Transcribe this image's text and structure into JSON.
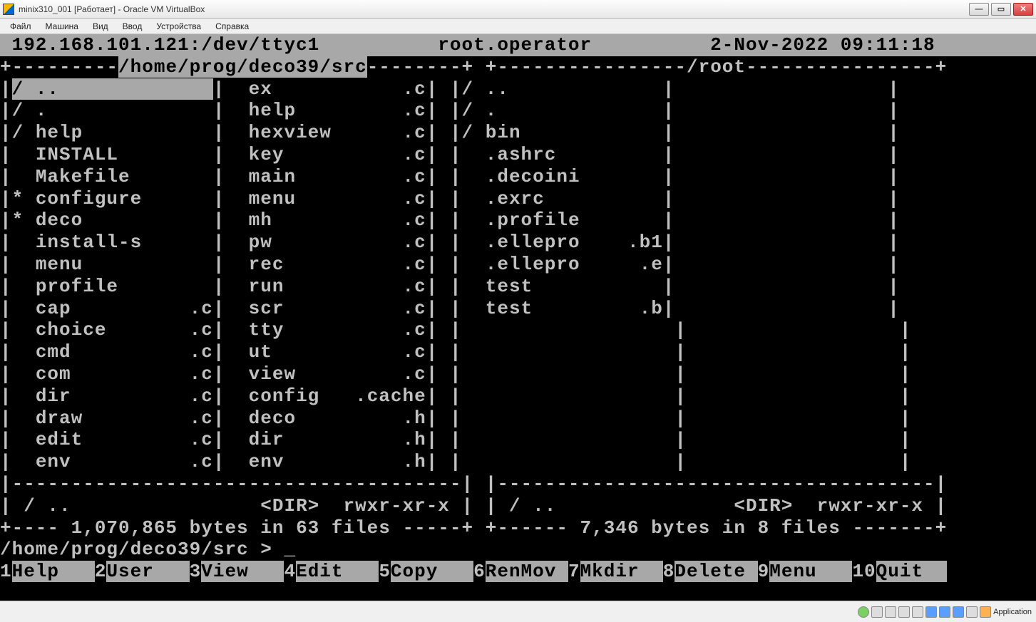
{
  "window": {
    "title": "minix310_001 [Работает] - Oracle VM VirtualBox"
  },
  "menubar": [
    "Файл",
    "Машина",
    "Вид",
    "Ввод",
    "Устройства",
    "Справка"
  ],
  "term": {
    "header": {
      "host": "192.168.101.121:/dev/ttyc1",
      "user": "root.operator",
      "datetime": "2-Nov-2022 09:11:18"
    },
    "left": {
      "path": "/home/prog/deco39/src",
      "col1": [
        {
          "m": "/",
          "name": "..",
          "ext": ""
        },
        {
          "m": "/",
          "name": ".",
          "ext": ""
        },
        {
          "m": "/",
          "name": "help",
          "ext": ""
        },
        {
          "m": " ",
          "name": "INSTALL",
          "ext": ""
        },
        {
          "m": " ",
          "name": "Makefile",
          "ext": ""
        },
        {
          "m": "*",
          "name": "configure",
          "ext": ""
        },
        {
          "m": "*",
          "name": "deco",
          "ext": ""
        },
        {
          "m": " ",
          "name": "install-sh",
          "ext": ""
        },
        {
          "m": " ",
          "name": "menu",
          "ext": ""
        },
        {
          "m": " ",
          "name": "profile",
          "ext": ""
        },
        {
          "m": " ",
          "name": "cap",
          "ext": ".c"
        },
        {
          "m": " ",
          "name": "choice",
          "ext": ".c"
        },
        {
          "m": " ",
          "name": "cmd",
          "ext": ".c"
        },
        {
          "m": " ",
          "name": "com",
          "ext": ".c"
        },
        {
          "m": " ",
          "name": "dir",
          "ext": ".c"
        },
        {
          "m": " ",
          "name": "draw",
          "ext": ".c"
        },
        {
          "m": " ",
          "name": "edit",
          "ext": ".c"
        },
        {
          "m": " ",
          "name": "env",
          "ext": ".c"
        }
      ],
      "col2": [
        {
          "m": " ",
          "name": "ex",
          "ext": ".c"
        },
        {
          "m": " ",
          "name": "help",
          "ext": ".c"
        },
        {
          "m": " ",
          "name": "hexview",
          "ext": ".c"
        },
        {
          "m": " ",
          "name": "key",
          "ext": ".c"
        },
        {
          "m": " ",
          "name": "main",
          "ext": ".c"
        },
        {
          "m": " ",
          "name": "menu",
          "ext": ".c"
        },
        {
          "m": " ",
          "name": "mh",
          "ext": ".c"
        },
        {
          "m": " ",
          "name": "pw",
          "ext": ".c"
        },
        {
          "m": " ",
          "name": "rec",
          "ext": ".c"
        },
        {
          "m": " ",
          "name": "run",
          "ext": ".c"
        },
        {
          "m": " ",
          "name": "scr",
          "ext": ".c"
        },
        {
          "m": " ",
          "name": "tty",
          "ext": ".c"
        },
        {
          "m": " ",
          "name": "ut",
          "ext": ".c"
        },
        {
          "m": " ",
          "name": "view",
          "ext": ".c"
        },
        {
          "m": " ",
          "name": "config",
          "ext": ".cache"
        },
        {
          "m": " ",
          "name": "deco",
          "ext": ".h"
        },
        {
          "m": " ",
          "name": "dir",
          "ext": ".h"
        },
        {
          "m": " ",
          "name": "env",
          "ext": ".h"
        }
      ],
      "status": {
        "m": "/",
        "name": "..",
        "type": "<DIR>",
        "perms": "rwxr-xr-x"
      },
      "footer": "1,070,865 bytes in 63 files"
    },
    "right": {
      "path": "/root",
      "col1": [
        {
          "m": "/",
          "name": "..",
          "ext": ""
        },
        {
          "m": "/",
          "name": ".",
          "ext": ""
        },
        {
          "m": "/",
          "name": "bin",
          "ext": ""
        },
        {
          "m": " ",
          "name": ".ashrc",
          "ext": ""
        },
        {
          "m": " ",
          "name": ".decoini",
          "ext": ""
        },
        {
          "m": " ",
          "name": ".exrc",
          "ext": ""
        },
        {
          "m": " ",
          "name": ".profile",
          "ext": ""
        },
        {
          "m": " ",
          "name": ".ellepro",
          "ext": ".b1"
        },
        {
          "m": " ",
          "name": ".ellepro",
          "ext": ".e"
        },
        {
          "m": " ",
          "name": "test",
          "ext": ""
        },
        {
          "m": " ",
          "name": "test",
          "ext": ".b"
        }
      ],
      "status": {
        "m": "/",
        "name": "..",
        "type": "<DIR>",
        "perms": "rwxr-xr-x"
      },
      "footer": "7,346 bytes in 8 files"
    },
    "prompt": "/home/prog/deco39/src >",
    "fkeys": [
      {
        "n": "1",
        "label": "Help"
      },
      {
        "n": "2",
        "label": "User"
      },
      {
        "n": "3",
        "label": "View"
      },
      {
        "n": "4",
        "label": "Edit"
      },
      {
        "n": "5",
        "label": "Copy"
      },
      {
        "n": "6",
        "label": "RenMov"
      },
      {
        "n": "7",
        "label": "Mkdir"
      },
      {
        "n": "8",
        "label": "Delete"
      },
      {
        "n": "9",
        "label": "Menu"
      },
      {
        "n": "10",
        "label": "Quit"
      }
    ]
  },
  "statusbar": {
    "app": "Application"
  }
}
